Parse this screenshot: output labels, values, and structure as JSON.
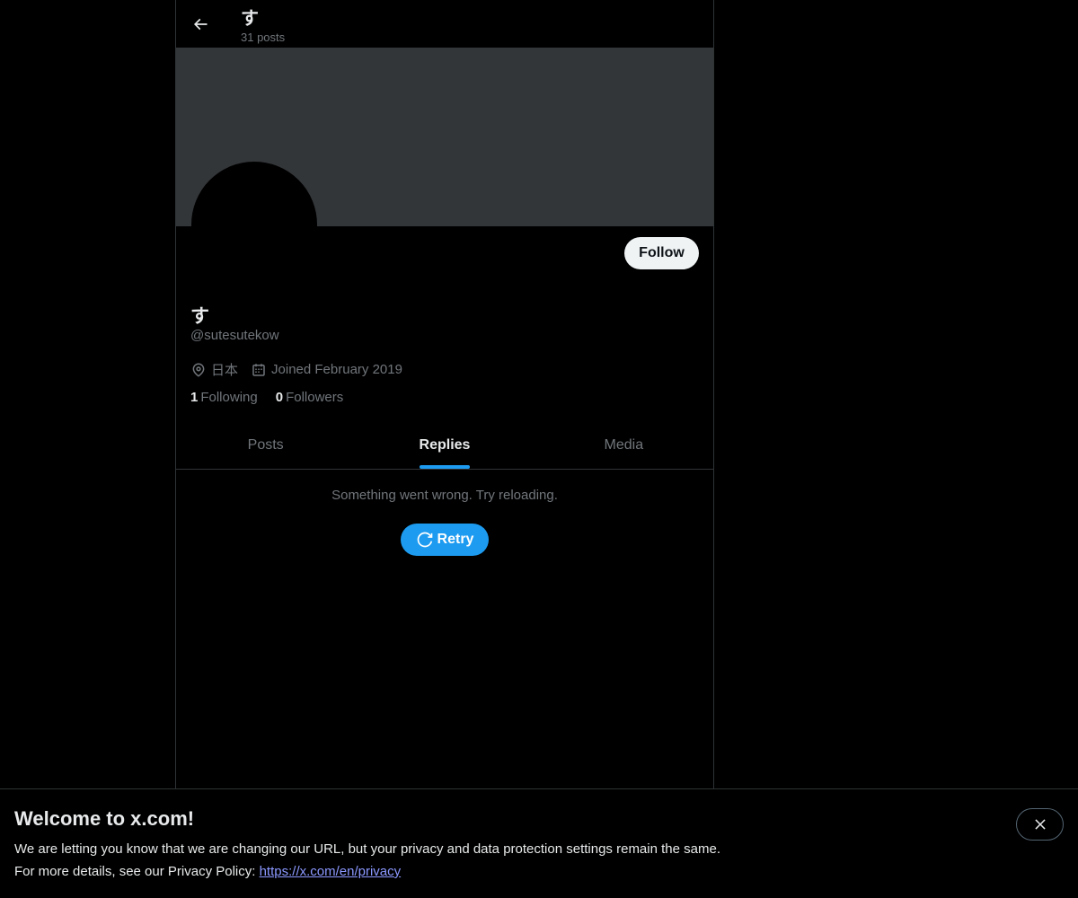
{
  "header": {
    "name": "す",
    "posts_count": "31 posts"
  },
  "profile": {
    "display_name": "す",
    "handle": "@sutesutekow",
    "location": "日本",
    "joined": "Joined February 2019",
    "following_count": "1",
    "following_label": "Following",
    "followers_count": "0",
    "followers_label": "Followers",
    "follow_label": "Follow"
  },
  "tabs": [
    {
      "label": "Posts",
      "active": false
    },
    {
      "label": "Replies",
      "active": true
    },
    {
      "label": "Media",
      "active": false
    }
  ],
  "error": {
    "message": "Something went wrong. Try reloading.",
    "retry_label": "Retry"
  },
  "banner_notice": {
    "title": "Welcome to x.com!",
    "line1": "We are letting you know that we are changing our URL, but your privacy and data protection settings remain the same.",
    "line2_prefix": "For more details, see our Privacy Policy: ",
    "link_text": "https://x.com/en/privacy"
  },
  "colors": {
    "accent": "#1d9bf0",
    "background": "#000000",
    "banner": "#333639",
    "secondary_text": "#71767b"
  },
  "icons": [
    "back-arrow-icon",
    "location-pin-icon",
    "calendar-icon",
    "refresh-icon",
    "close-icon"
  ]
}
